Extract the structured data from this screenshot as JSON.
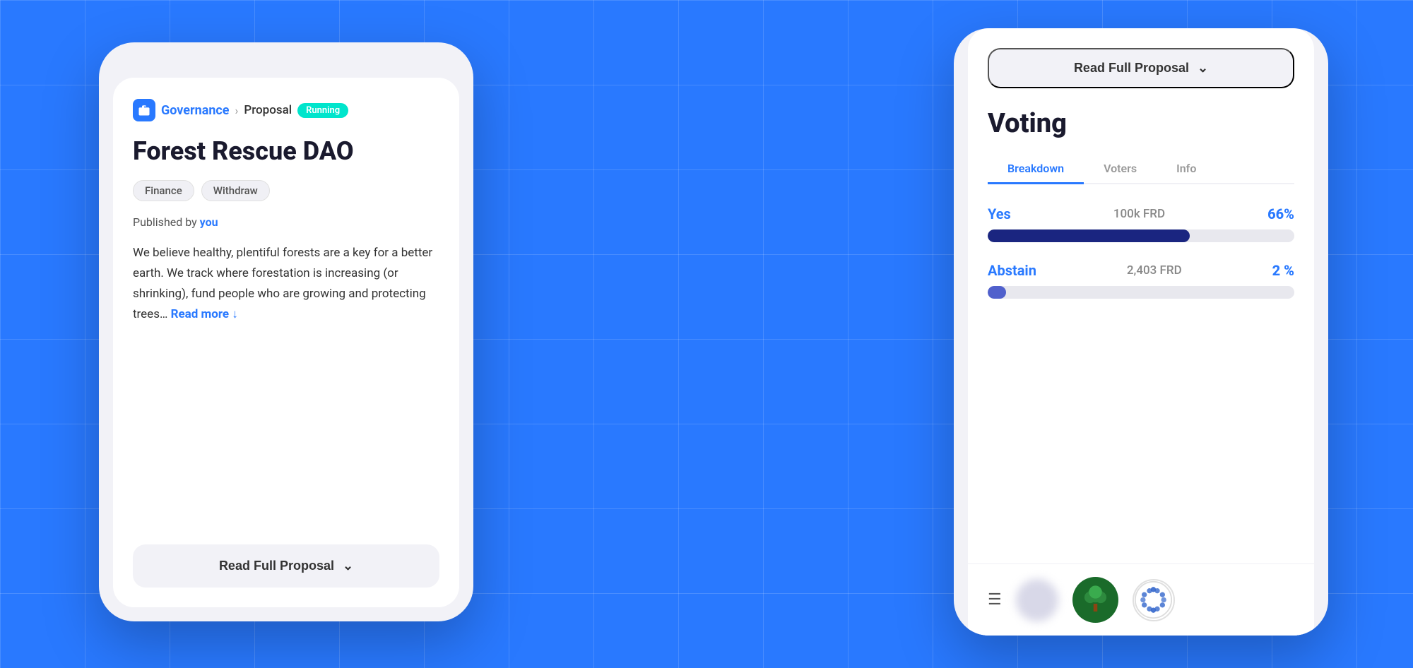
{
  "background": {
    "color": "#2979FF"
  },
  "left_phone": {
    "breadcrumb": {
      "governance_label": "Governance",
      "proposal_label": "Proposal",
      "status_badge": "Running"
    },
    "title": "Forest Rescue DAO",
    "tags": [
      "Finance",
      "Withdraw"
    ],
    "published_by": {
      "label": "Published by",
      "author": "you"
    },
    "description": "We believe healthy, plentiful forests are a key for a better earth. We track where forestation is increasing (or shrinking), fund people who are growing and protecting trees…",
    "read_more": "Read more ↓",
    "read_full_proposal_btn": "Read Full Proposal"
  },
  "right_phone": {
    "read_full_proposal_btn": "Read Full Proposal",
    "voting_title": "Voting",
    "tabs": [
      {
        "label": "Breakdown",
        "active": true
      },
      {
        "label": "Voters",
        "active": false
      },
      {
        "label": "Info",
        "active": false
      }
    ],
    "votes": [
      {
        "label": "Yes",
        "amount": "100k FRD",
        "percent": "66%",
        "bar_width": "66%",
        "bar_class": "yes"
      },
      {
        "label": "Abstain",
        "amount": "2,403 FRD",
        "percent": "2 %",
        "bar_width": "6%",
        "bar_class": "abstain"
      }
    ]
  }
}
